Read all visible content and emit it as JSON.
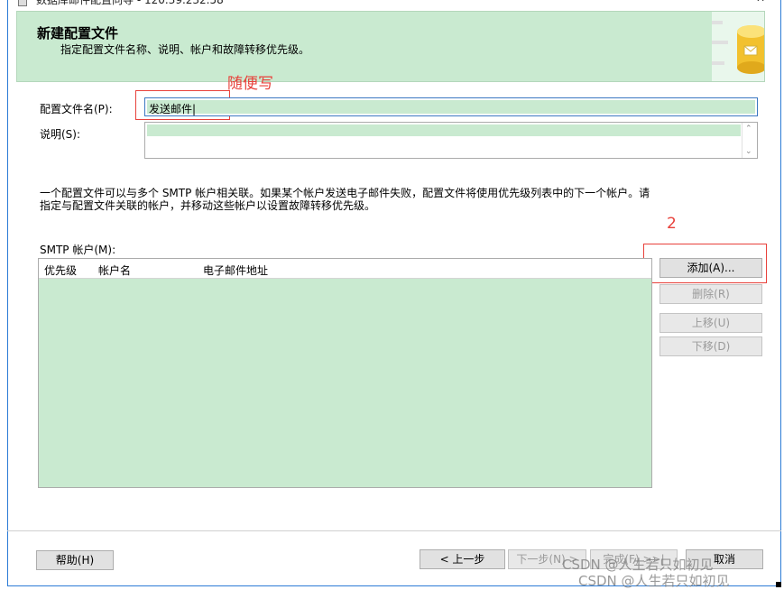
{
  "window": {
    "title": "数据库邮件配置向导 - 120.39.232.58",
    "min_glyph": "—",
    "close_glyph": "✕"
  },
  "header": {
    "title": "新建配置文件",
    "subtitle": "指定配置文件名称、说明、帐户和故障转移优先级。"
  },
  "annotations": {
    "write_anything": "随便写",
    "step2": "2"
  },
  "form": {
    "name_label": "配置文件名(P):",
    "name_value": "发送邮件|",
    "desc_label": "说明(S):",
    "desc_value": ""
  },
  "info_text": {
    "line1": "一个配置文件可以与多个 SMTP 帐户相关联。如果某个帐户发送电子邮件失败，配置文件将使用优先级列表中的下一个帐户。请",
    "line2": "指定与配置文件关联的帐户，并移动这些帐户以设置故障转移优先级。"
  },
  "accounts": {
    "label": "SMTP 帐户(M):",
    "columns": [
      "优先级",
      "帐户名",
      "电子邮件地址"
    ],
    "rows": []
  },
  "buttons": {
    "add": "添加(A)...",
    "remove": "删除(R)",
    "move_up": "上移(U)",
    "move_down": "下移(D)",
    "help": "帮助(H)",
    "back": "< 上一步",
    "next": "下一步(N) >",
    "finish": "完成(F) >>|",
    "cancel": "取消"
  },
  "watermark": {
    "line1": "CSDN @人生若只如初见",
    "line2": "CSDN @人生若只如初见"
  },
  "colors": {
    "accent_green": "#c9ead0",
    "annotation_red": "#e8413b",
    "focus_blue": "#3b78c2"
  }
}
